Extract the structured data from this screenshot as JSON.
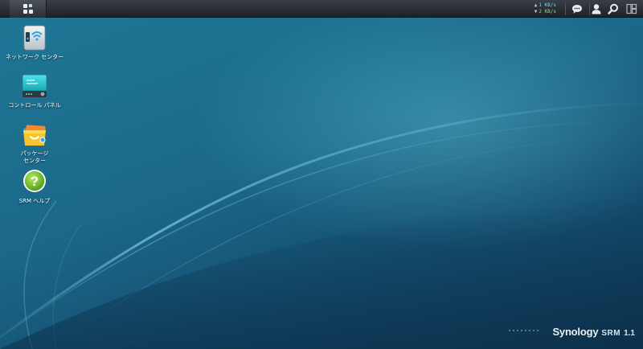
{
  "taskbar": {
    "main_menu_icon": "grid-icon",
    "traffic": {
      "upload_value": "1 KB/s",
      "download_value": "2 KB/s"
    },
    "tray_icons": [
      "chat-icon",
      "user-icon",
      "search-icon",
      "widgets-icon"
    ]
  },
  "desktop": {
    "icons": [
      {
        "label": "ネットワーク センター",
        "icon": "network-center-icon"
      },
      {
        "label": "コントロール パネル",
        "icon": "control-panel-icon"
      },
      {
        "label": "パッケージ\nセンター",
        "icon": "package-center-icon"
      },
      {
        "label": "SRM ヘルプ",
        "icon": "help-icon"
      }
    ]
  },
  "brand": {
    "logo": "Synology",
    "product": "SRM",
    "version": "1.1"
  },
  "colors": {
    "desktop_top": "#1e7796",
    "desktop_bottom": "#0e3553",
    "taskbar": "#2a2e34",
    "upload_text": "#6fd0ff",
    "download_text": "#7fe07f"
  }
}
